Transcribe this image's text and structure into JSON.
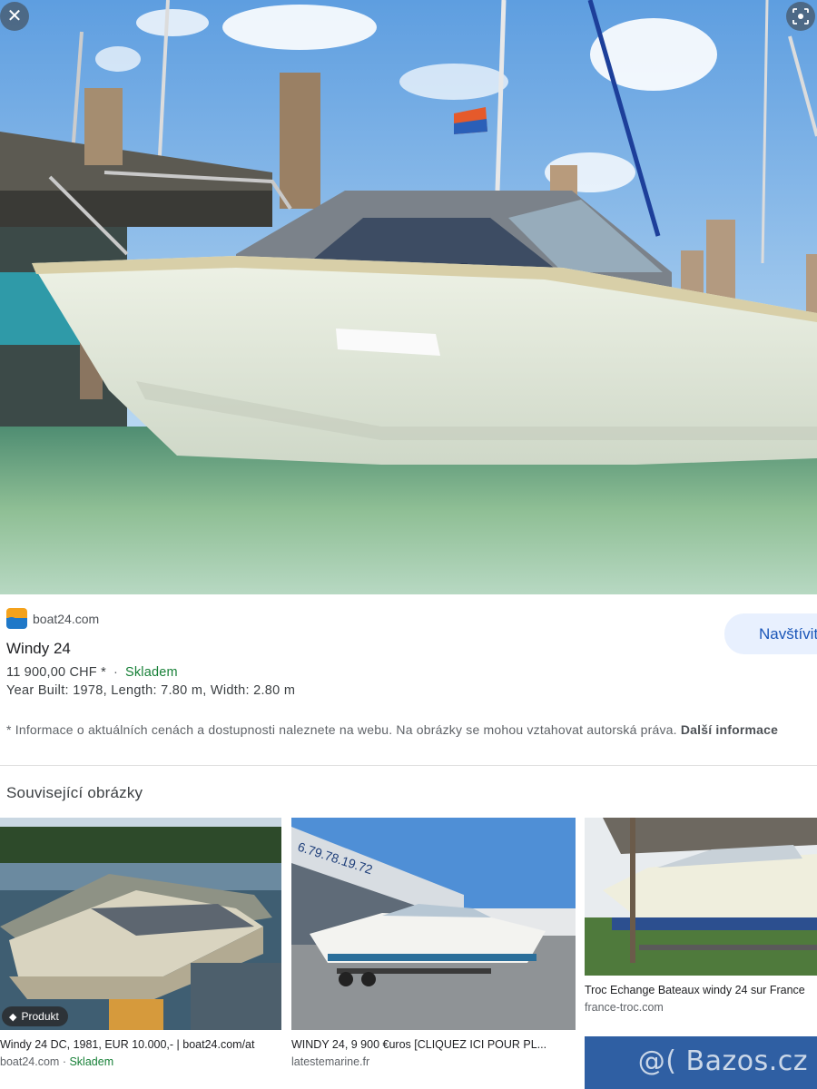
{
  "hero": {
    "close_icon": "close-icon",
    "lens_icon": "lens-icon",
    "colors": {
      "sky": "#7fb6e8",
      "water": "#6aa58a",
      "hull": "#e6ecdf"
    }
  },
  "source": {
    "favicon": "boat24-favicon",
    "name": "boat24.com"
  },
  "visit_button": {
    "label": "Navštívit"
  },
  "product": {
    "title": "Windy 24",
    "price": "11 900,00 CHF *",
    "separator": "·",
    "availability": "Skladem",
    "specs": "Year Built: 1978, Length: 7.80 m, Width: 2.80 m"
  },
  "disclaimer": {
    "text": "* Informace o aktuálních cenách a dostupnosti naleznete na webu. Na obrázky se mohou vztahovat autorská práva.",
    "more": "Další informace"
  },
  "related": {
    "heading": "Související obrázky",
    "items": [
      {
        "caption": "Windy 24 DC, 1981, EUR 10.000,- | boat24.com/at",
        "source": "boat24.com",
        "separator": "·",
        "availability": "Skladem",
        "badge": "Produkt"
      },
      {
        "caption": "WINDY 24, 9 900 €uros [CLIQUEZ ICI POUR PL...",
        "source": "latestemarine.fr",
        "sign_text": "6.79.78.19.72"
      },
      {
        "caption": "Troc Echange Bateaux windy 24 sur France",
        "source": "france-troc.com"
      }
    ]
  },
  "watermark": {
    "text": "@( Bazos.cz"
  },
  "colors": {
    "accent_blue": "#1a56b8",
    "stock_green": "#188038",
    "visit_bg": "#e8f0fe"
  }
}
